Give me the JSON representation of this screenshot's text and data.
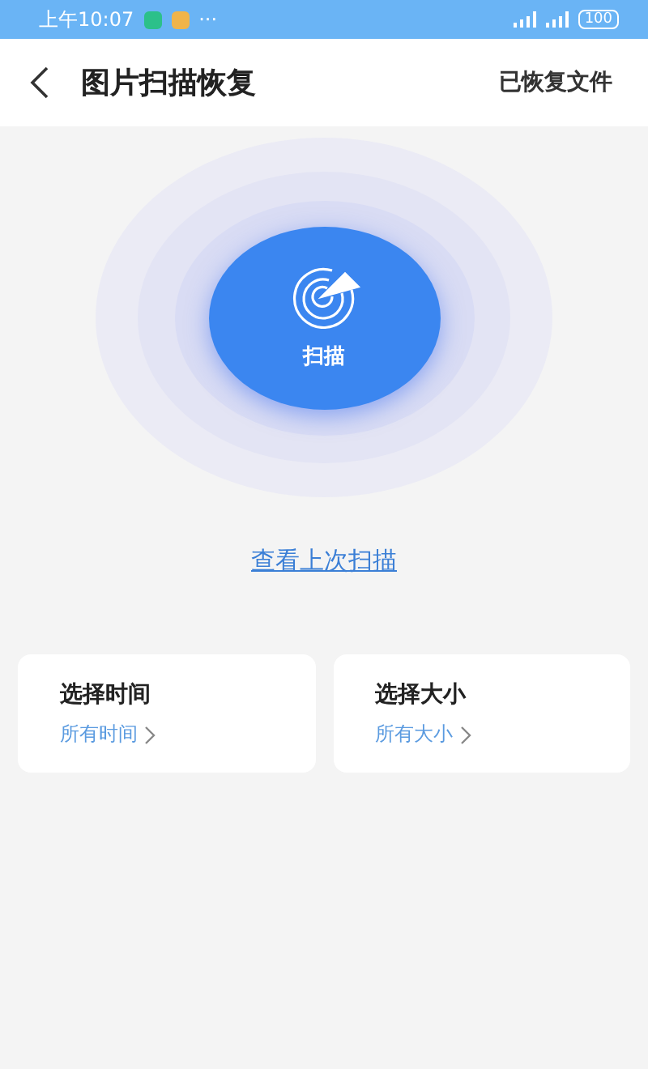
{
  "status_bar": {
    "time": "上午10:07",
    "more": "···",
    "battery": "100"
  },
  "header": {
    "title": "图片扫描恢复",
    "action": "已恢复文件"
  },
  "scan_button": {
    "label": "扫描"
  },
  "last_scan_link": "查看上次扫描",
  "filters": [
    {
      "title": "选择时间",
      "value": "所有时间"
    },
    {
      "title": "选择大小",
      "value": "所有大小"
    }
  ]
}
